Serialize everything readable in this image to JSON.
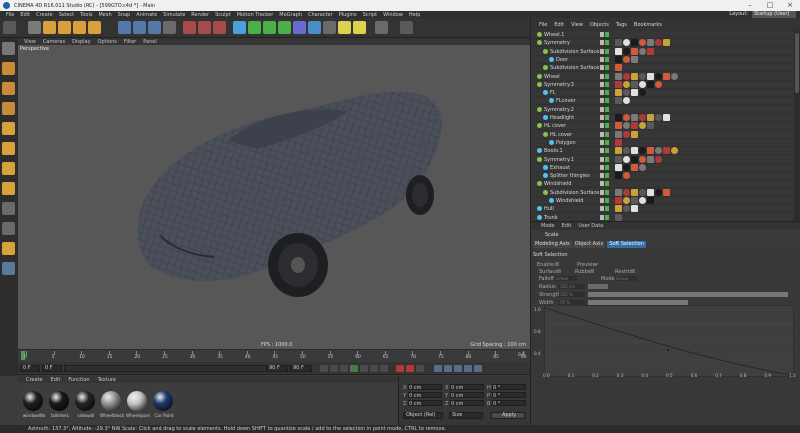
{
  "window": {
    "title": "CINEMA 4D R16.011 Studio (RC) - [599GTO.c4d *] - Main",
    "layout_label": "Layout:",
    "layout_value": "Startup (User)"
  },
  "menu": [
    "File",
    "Edit",
    "Create",
    "Select",
    "Tools",
    "Mesh",
    "Snap",
    "Animate",
    "Simulate",
    "Render",
    "Sculpt",
    "Motion Tracker",
    "MoGraph",
    "Character",
    "Plugins",
    "Script",
    "Window",
    "Help"
  ],
  "viewport": {
    "menu": [
      "View",
      "Cameras",
      "Display",
      "Options",
      "Filter",
      "Panel"
    ],
    "camera": "Perspective",
    "fps": "FPS : 1000.0",
    "grid_spacing": "Grid Spacing : 100 cm"
  },
  "timeline": {
    "ticks": [
      "0",
      "5",
      "10",
      "15",
      "20",
      "25",
      "30",
      "35",
      "40",
      "45",
      "50",
      "55",
      "60",
      "65",
      "70",
      "75",
      "80",
      "85",
      "90"
    ],
    "end_label": "0 F"
  },
  "transport": {
    "current_frame": "0 F",
    "min_frame": "0 F",
    "max_frame": "90 F",
    "end_frame": "90 F"
  },
  "materials": {
    "menu": [
      "Create",
      "Edit",
      "Function",
      "Texture"
    ],
    "items": [
      {
        "name": "windowWa",
        "color": "#202020"
      },
      {
        "name": "tailinterL",
        "color": "#1a1a1a"
      },
      {
        "name": "sidewall",
        "color": "#252525"
      },
      {
        "name": "Wheelblock",
        "color": "#9a9a9a"
      },
      {
        "name": "Wheelspare",
        "color": "#c8c8c8"
      },
      {
        "name": "Car Paint",
        "color": "#1f3a6e"
      }
    ]
  },
  "coords": {
    "rows": [
      {
        "a": "X",
        "b": "0 cm",
        "c": "X",
        "d": "0 cm",
        "e": "H",
        "f": "0 °"
      },
      {
        "a": "Y",
        "b": "0 cm",
        "c": "Y",
        "d": "0 cm",
        "e": "P",
        "f": "0 °"
      },
      {
        "a": "Z",
        "b": "0 cm",
        "c": "Z",
        "d": "0 cm",
        "e": "B",
        "f": "0 °"
      }
    ],
    "mode": "Object (Rel)",
    "size_mode": "Size",
    "apply": "Apply"
  },
  "status": "Azimuth: 137.3°, Altitude: -29.3°  NW    Scale: Click and drag to scale elements. Hold down SHIFT to quantize scale / add to the selection in point mode, CTRL to remove.",
  "objects": {
    "menu": [
      "File",
      "Edit",
      "View",
      "Objects",
      "Tags",
      "Bookmarks"
    ],
    "rows": [
      {
        "name": "Wheel.1",
        "level": 0,
        "color": "#8bc34a"
      },
      {
        "name": "Symmetry",
        "level": 0,
        "color": "#8bc34a"
      },
      {
        "name": "Subdivision Surface.1",
        "level": 1,
        "color": "#8bc34a"
      },
      {
        "name": "Door",
        "level": 2,
        "color": "#4fc3f7"
      },
      {
        "name": "Subdivision Surface",
        "level": 1,
        "color": "#8bc34a"
      },
      {
        "name": "Wheel",
        "level": 0,
        "color": "#8bc34a"
      },
      {
        "name": "Symmetry.3",
        "level": 0,
        "color": "#8bc34a"
      },
      {
        "name": "FL",
        "level": 1,
        "color": "#4fc3f7"
      },
      {
        "name": "FLcover",
        "level": 2,
        "color": "#4fc3f7"
      },
      {
        "name": "Symmetry.2",
        "level": 0,
        "color": "#8bc34a"
      },
      {
        "name": "Headlight",
        "level": 1,
        "color": "#4fc3f7"
      },
      {
        "name": "HL cover",
        "level": 0,
        "color": "#8bc34a"
      },
      {
        "name": "HL cover",
        "level": 1,
        "color": "#8bc34a"
      },
      {
        "name": "Polygon",
        "level": 2,
        "color": "#4fc3f7"
      },
      {
        "name": "Boolo.1",
        "level": 0,
        "color": "#4fc3f7"
      },
      {
        "name": "Symmetry.1",
        "level": 0,
        "color": "#8bc34a"
      },
      {
        "name": "Exhaust",
        "level": 1,
        "color": "#4fc3f7"
      },
      {
        "name": "Splitter thingies",
        "level": 1,
        "color": "#4fc3f7"
      },
      {
        "name": "Windshield",
        "level": 0,
        "color": "#8bc34a"
      },
      {
        "name": "Subdivision Surface",
        "level": 1,
        "color": "#8bc34a"
      },
      {
        "name": "Windshield",
        "level": 2,
        "color": "#4fc3f7"
      },
      {
        "name": "Hull",
        "level": 0,
        "color": "#4fc3f7"
      },
      {
        "name": "Trunk",
        "level": 0,
        "color": "#4fc3f7"
      }
    ]
  },
  "attributes": {
    "menu": [
      "Mode",
      "Edit",
      "User Data"
    ],
    "title": "Scale",
    "tabs": [
      "Modeling Axis",
      "Object Axis",
      "Soft Selection"
    ],
    "active_tab": 2,
    "section": "Soft Selection",
    "enable_label": "Enable",
    "preview_label": "Preview",
    "surface_label": "Surface",
    "rubber_label": "Rubber",
    "restrict_label": "Restrict",
    "falloff_label": "Falloff",
    "falloff_value": "Linear",
    "mode_label": "Mode",
    "mode_value": "Group",
    "radius_label": "Radius",
    "radius_value": "100 cm",
    "strength_label": "Strength",
    "strength_value": "100 %",
    "width_label": "Width",
    "width_value": "50 %",
    "graph_x": [
      "0.0",
      "0.1",
      "0.2",
      "0.3",
      "0.4",
      "0.5",
      "0.6",
      "0.7",
      "0.8",
      "0.9",
      "1.0"
    ],
    "graph_y": [
      "1.0",
      "0.8",
      "0.4"
    ]
  }
}
